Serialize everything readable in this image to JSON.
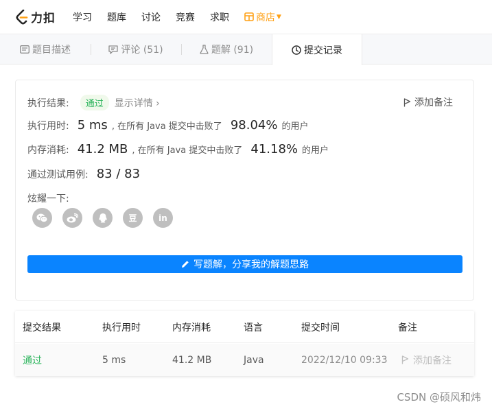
{
  "brand": {
    "name": "力扣",
    "accent": "#ffa116"
  },
  "nav": {
    "items": [
      "学习",
      "题库",
      "讨论",
      "竞赛",
      "求职"
    ],
    "store": "商店"
  },
  "tabs": [
    {
      "label": "题目描述",
      "icon": "description-icon"
    },
    {
      "label": "评论 (51)",
      "icon": "comment-icon"
    },
    {
      "label": "题解 (91)",
      "icon": "flask-icon"
    },
    {
      "label": "提交记录",
      "icon": "clock-icon",
      "active": true
    }
  ],
  "result": {
    "status_label": "执行结果:",
    "status": "通过",
    "detail_link": "显示详情 ›",
    "add_note": "添加备注",
    "runtime_label": "执行用时:",
    "runtime": "5 ms",
    "runtime_mid": ", 在所有 Java 提交中击败了",
    "runtime_pct": "98.04%",
    "runtime_tail": "的用户",
    "memory_label": "内存消耗:",
    "memory": "41.2 MB",
    "memory_mid": ", 在所有 Java 提交中击败了",
    "memory_pct": "41.18%",
    "memory_tail": "的用户",
    "tests_label": "通过测试用例:",
    "tests": "83 / 83",
    "share_label": "炫耀一下:",
    "share": [
      "wechat-icon",
      "weibo-icon",
      "qq-icon",
      "douban-icon",
      "linkedin-icon"
    ],
    "douban_glyph": "豆",
    "linkedin_glyph": "in",
    "write_button": "写题解，分享我的解题思路"
  },
  "table": {
    "headers": [
      "提交结果",
      "执行用时",
      "内存消耗",
      "语言",
      "提交时间",
      "备注"
    ],
    "rows": [
      {
        "result": "通过",
        "runtime": "5 ms",
        "memory": "41.2 MB",
        "lang": "Java",
        "time": "2022/12/10 09:33",
        "note": "添加备注"
      }
    ]
  },
  "watermark": "CSDN @硕风和炜",
  "colors": {
    "success": "#2db55d",
    "primary": "#0a84ff",
    "muted": "#8c8c8c"
  }
}
